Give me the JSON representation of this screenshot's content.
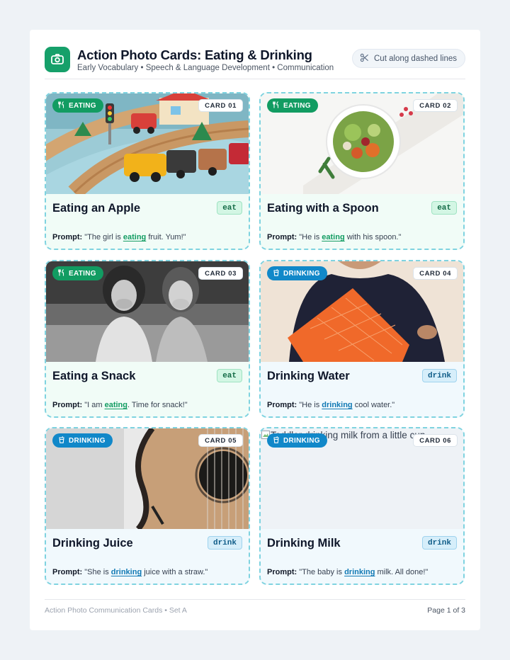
{
  "header": {
    "title": "Action Photo Cards: Eating & Drinking",
    "subtitle": "Early Vocabulary • Speech & Language Development • Communication",
    "cut_label": "Cut along dashed lines",
    "logo_icon": "camera-icon"
  },
  "cards": [
    {
      "tag": "EATING",
      "number": "CARD 01",
      "title": "Eating an Apple",
      "word": "eat",
      "prompt_label": "Prompt:",
      "prompt_before": "\"The girl is ",
      "prompt_verb": "eating",
      "prompt_after": " fruit. Yum!\""
    },
    {
      "tag": "EATING",
      "number": "CARD 02",
      "title": "Eating with a Spoon",
      "word": "eat",
      "prompt_label": "Prompt:",
      "prompt_before": "\"He is ",
      "prompt_verb": "eating",
      "prompt_after": " with his spoon.\""
    },
    {
      "tag": "EATING",
      "number": "CARD 03",
      "title": "Eating a Snack",
      "word": "eat",
      "prompt_label": "Prompt:",
      "prompt_before": "\"I am ",
      "prompt_verb": "eating",
      "prompt_after": ". Time for snack!\""
    },
    {
      "tag": "DRINKING",
      "number": "CARD 04",
      "title": "Drinking Water",
      "word": "drink",
      "prompt_label": "Prompt:",
      "prompt_before": "\"He is ",
      "prompt_verb": "drinking",
      "prompt_after": " cool water.\""
    },
    {
      "tag": "DRINKING",
      "number": "CARD 05",
      "title": "Drinking Juice",
      "word": "drink",
      "prompt_label": "Prompt:",
      "prompt_before": "\"She is ",
      "prompt_verb": "drinking",
      "prompt_after": " juice with a straw.\""
    },
    {
      "tag": "DRINKING",
      "number": "CARD 06",
      "title": "Drinking Milk",
      "word": "drink",
      "prompt_label": "Prompt:",
      "prompt_before": "\"The baby is ",
      "prompt_verb": "drinking",
      "prompt_after": " milk. All done!\"",
      "image_alt": "Toddler drinking milk from a little cup"
    }
  ],
  "footer": {
    "left": "Action Photo Communication Cards • Set A",
    "right": "Page 1 of 3"
  },
  "colors": {
    "eat_accent": "#129c62",
    "drink_accent": "#1188c9",
    "dashed_border": "#7fd3e0"
  }
}
